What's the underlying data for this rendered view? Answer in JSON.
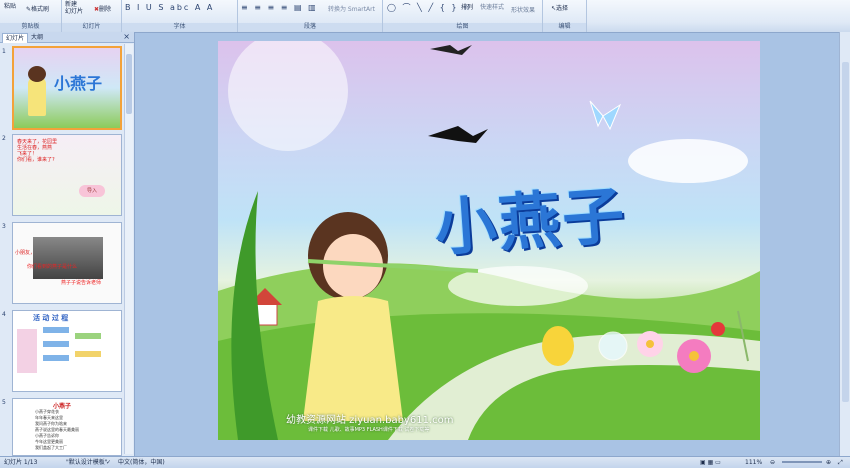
{
  "ribbon": {
    "clipboard": {
      "paste": "粘贴",
      "format_painter": "格式刷",
      "label": "剪贴板"
    },
    "slides": {
      "new_slide": "新建\n幻灯片",
      "delete": "删除",
      "label": "幻灯片"
    },
    "font": {
      "label": "字体"
    },
    "paragraph": {
      "smartart": "转换为 SmartArt",
      "label": "段落"
    },
    "drawing": {
      "arrange": "排列",
      "quick_styles": "快速样式",
      "shape_effects": "形状效果",
      "label": "绘图"
    },
    "editing": {
      "select": "选择",
      "label": "编辑"
    }
  },
  "pane": {
    "tab_slides": "幻灯片",
    "tab_outline": "大纲",
    "close": "×"
  },
  "thumbnails": [
    {
      "num": "1",
      "title": "小燕子"
    },
    {
      "num": "2",
      "text": "春天来了，花园里\n生活在春，燕燕\n飞来了！\n你们看，谁来了?",
      "button": "导入"
    },
    {
      "num": "3",
      "text1": "小朋友，",
      "text2": "你们看到的燕子是什么",
      "text3": "燕子子说告诉老师"
    },
    {
      "num": "4",
      "title": "活 动 过 程"
    },
    {
      "num": "5",
      "title": "小燕子",
      "lines": [
        "小燕子穿花衣",
        "年年春天来这里",
        "我问燕子你为啥来",
        "燕子说这里的春天最美丽",
        "小燕子告诉你",
        "今年这里更美丽",
        "我们盖起了大工厂"
      ]
    }
  ],
  "slide": {
    "title": "小燕子",
    "watermark": "幼教资源网站  ziyuan.baby611.com",
    "watermark_sub": "课件下载    儿歌、故事MP3    FLASH课件下载    试卷下载等"
  },
  "status": {
    "slide_count": "幻灯片 1/13",
    "theme": "\"默认设计模板\"",
    "language": "中文(简体，中国)",
    "zoom": "111%"
  },
  "colors": {
    "title_blue": "#2b76d6",
    "selection_orange": "#f3a23a",
    "ribbon_bg": "#dfe9f6"
  }
}
